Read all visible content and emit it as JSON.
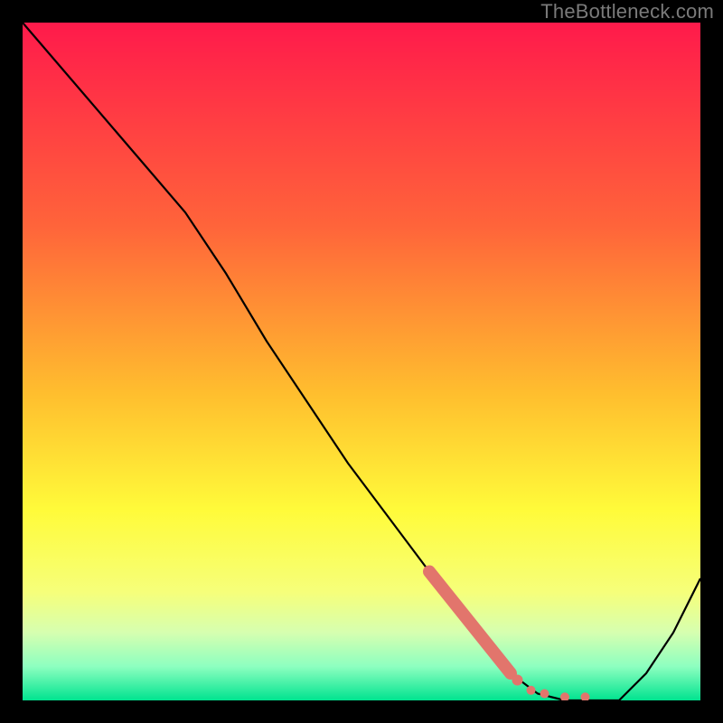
{
  "attribution": "TheBottleneck.com",
  "chart_data": {
    "type": "line",
    "title": "",
    "xlabel": "",
    "ylabel": "",
    "xlim": [
      0,
      100
    ],
    "ylim": [
      0,
      100
    ],
    "grid": false,
    "legend": false,
    "gradient_stops": [
      {
        "offset": 0.0,
        "color": "#ff1a4b"
      },
      {
        "offset": 0.3,
        "color": "#ff643a"
      },
      {
        "offset": 0.55,
        "color": "#ffbf2e"
      },
      {
        "offset": 0.72,
        "color": "#fffb3a"
      },
      {
        "offset": 0.84,
        "color": "#f6ff7a"
      },
      {
        "offset": 0.9,
        "color": "#d6ffb0"
      },
      {
        "offset": 0.95,
        "color": "#8dffc0"
      },
      {
        "offset": 1.0,
        "color": "#00e38f"
      }
    ],
    "series": [
      {
        "name": "bottleneck-curve",
        "color": "#000000",
        "x": [
          0,
          6,
          12,
          18,
          24,
          30,
          36,
          42,
          48,
          54,
          60,
          66,
          72,
          76,
          80,
          84,
          88,
          92,
          96,
          100
        ],
        "y": [
          100,
          93,
          86,
          79,
          72,
          63,
          53,
          44,
          35,
          27,
          19,
          11,
          4,
          1,
          0,
          0,
          0,
          4,
          10,
          18
        ]
      }
    ],
    "highlight": {
      "name": "bottleneck-region",
      "color": "#e2756c",
      "style": "thick-then-dotted",
      "thick_segment": {
        "x": [
          60,
          72
        ],
        "y": [
          19,
          4
        ]
      },
      "dots": {
        "x": [
          73,
          75,
          77,
          80,
          83
        ],
        "y": [
          3,
          1.5,
          1,
          0.5,
          0.5
        ]
      }
    }
  }
}
